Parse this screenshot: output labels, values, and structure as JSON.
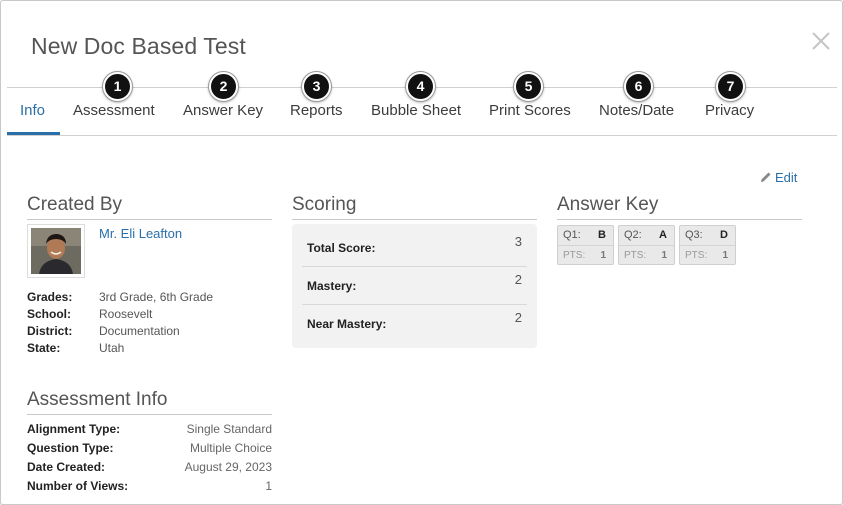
{
  "modal": {
    "title": "New Doc Based Test"
  },
  "tabs": [
    {
      "label": "Info",
      "badge": null
    },
    {
      "label": "Assessment",
      "badge": "1"
    },
    {
      "label": "Answer Key",
      "badge": "2"
    },
    {
      "label": "Reports",
      "badge": "3"
    },
    {
      "label": "Bubble Sheet",
      "badge": "4"
    },
    {
      "label": "Print Scores",
      "badge": "5"
    },
    {
      "label": "Notes/Date",
      "badge": "6"
    },
    {
      "label": "Privacy",
      "badge": "7"
    }
  ],
  "active_tab": "Info",
  "edit": {
    "label": "Edit",
    "icon": "pencil-icon"
  },
  "created_by": {
    "heading": "Created By",
    "name": "Mr. Eli Leafton",
    "grades_label": "Grades:",
    "grades": "3rd Grade, 6th Grade",
    "school_label": "School:",
    "school": "Roosevelt",
    "district_label": "District:",
    "district": "Documentation",
    "state_label": "State:",
    "state": "Utah"
  },
  "assessment_info": {
    "heading": "Assessment Info",
    "rows": [
      {
        "label": "Alignment Type:",
        "value": "Single Standard"
      },
      {
        "label": "Question Type:",
        "value": "Multiple Choice"
      },
      {
        "label": "Date Created:",
        "value": "August 29, 2023"
      },
      {
        "label": "Number of Views:",
        "value": "1"
      }
    ]
  },
  "scoring": {
    "heading": "Scoring",
    "rows": [
      {
        "label": "Total Score:",
        "value": "3"
      },
      {
        "label": "Mastery:",
        "value": "2"
      },
      {
        "label": "Near Mastery:",
        "value": "2"
      }
    ]
  },
  "answer_key": {
    "heading": "Answer Key",
    "pts_label": "PTS:",
    "items": [
      {
        "q": "Q1:",
        "answer": "B",
        "pts": "1"
      },
      {
        "q": "Q2:",
        "answer": "A",
        "pts": "1"
      },
      {
        "q": "Q3:",
        "answer": "D",
        "pts": "1"
      }
    ]
  },
  "colors": {
    "accent": "#2a6fa8",
    "badge": "#111111",
    "panel": "#f2f2f2"
  }
}
